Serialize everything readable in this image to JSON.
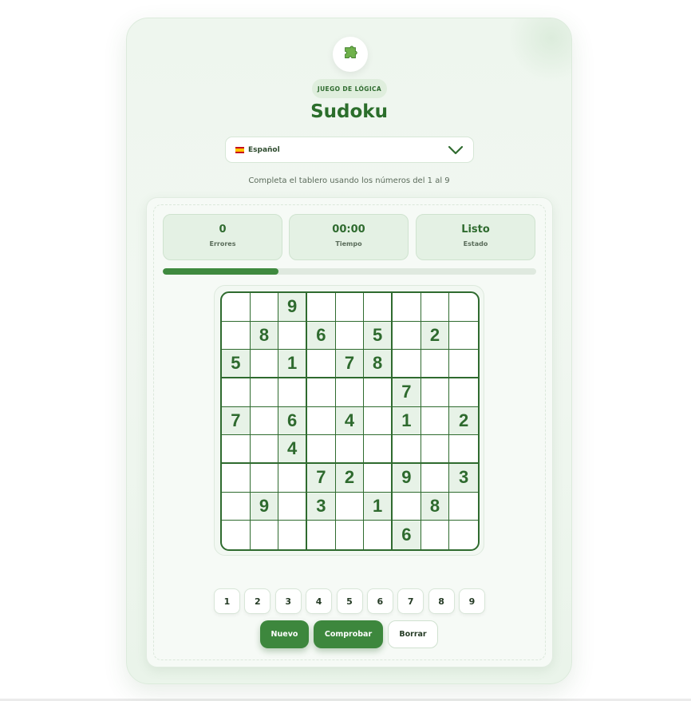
{
  "app": {
    "kicker": "JUEGO DE LÓGICA",
    "title": "Sudoku",
    "logo_icon": "puzzle-piece-icon",
    "subtitle": "Completa el tablero usando los números del 1 al 9"
  },
  "language": {
    "selected": "Español",
    "flag_icon": "spain-flag-icon",
    "chevron_icon": "chevron-down-icon"
  },
  "stats": [
    {
      "value": "0",
      "label": "Errores"
    },
    {
      "value": "00:00",
      "label": "Tiempo"
    },
    {
      "value": "Listo",
      "label": "Estado"
    }
  ],
  "progress": {
    "fraction": 0.31
  },
  "board": {
    "rows": [
      [
        "",
        "",
        "9",
        "",
        "",
        "",
        "",
        "",
        ""
      ],
      [
        "",
        "8",
        "",
        "6",
        "",
        "5",
        "",
        "2",
        ""
      ],
      [
        "5",
        "",
        "1",
        "",
        "7",
        "8",
        "",
        "",
        ""
      ],
      [
        "",
        "",
        "",
        "",
        "",
        "",
        "7",
        "",
        ""
      ],
      [
        "7",
        "",
        "6",
        "",
        "4",
        "",
        "1",
        "",
        "2"
      ],
      [
        "",
        "",
        "4",
        "",
        "",
        "",
        "",
        "",
        ""
      ],
      [
        "",
        "",
        "",
        "7",
        "2",
        "",
        "9",
        "",
        "3"
      ],
      [
        "",
        "9",
        "",
        "3",
        "",
        "1",
        "",
        "8",
        ""
      ],
      [
        "",
        "",
        "",
        "",
        "",
        "",
        "6",
        "",
        ""
      ]
    ]
  },
  "numpad": [
    "1",
    "2",
    "3",
    "4",
    "5",
    "6",
    "7",
    "8",
    "9"
  ],
  "actions": {
    "new_label": "Nuevo",
    "check_label": "Comprobar",
    "clear_label": "Borrar"
  },
  "colors": {
    "primary": "#3d873d",
    "text_green": "#2e6a2e",
    "given_cell": "#e7f2e7",
    "card_bg": "#eef6ee"
  }
}
